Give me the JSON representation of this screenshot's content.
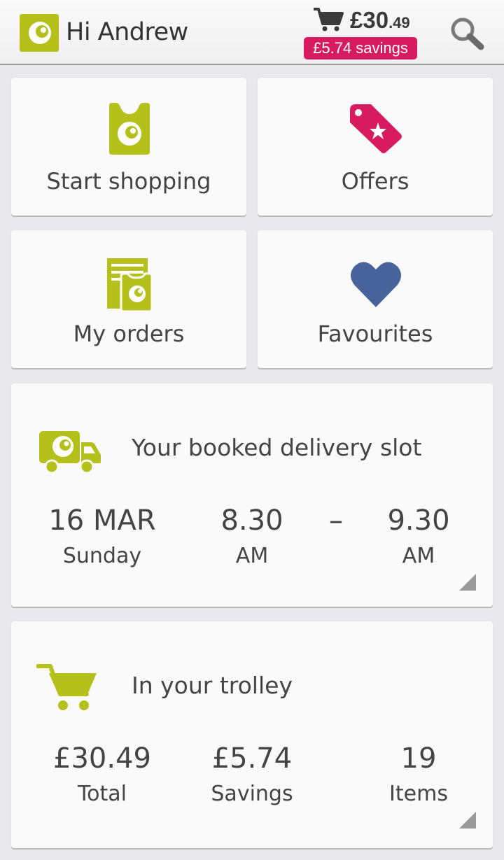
{
  "header": {
    "greeting": "Hi Andrew",
    "cart_total_pounds": "£30",
    "cart_total_pence": ".49",
    "savings_badge": "£5.74 savings",
    "brand_color": "#b5c11a",
    "badge_color": "#d81b60"
  },
  "tiles": [
    {
      "label": "Start shopping",
      "icon": "shopping-bag-icon"
    },
    {
      "label": "Offers",
      "icon": "offer-tag-icon"
    },
    {
      "label": "My orders",
      "icon": "orders-icon"
    },
    {
      "label": "Favourites",
      "icon": "heart-icon"
    }
  ],
  "delivery": {
    "title": "Your booked delivery slot",
    "date": "16 MAR",
    "day": "Sunday",
    "start_time": "8.30",
    "start_period": "AM",
    "separator": "–",
    "end_time": "9.30",
    "end_period": "AM"
  },
  "trolley": {
    "title": "In your trolley",
    "total_value": "£30.49",
    "total_label": "Total",
    "savings_value": "£5.74",
    "savings_label": "Savings",
    "items_value": "19",
    "items_label": "Items"
  }
}
